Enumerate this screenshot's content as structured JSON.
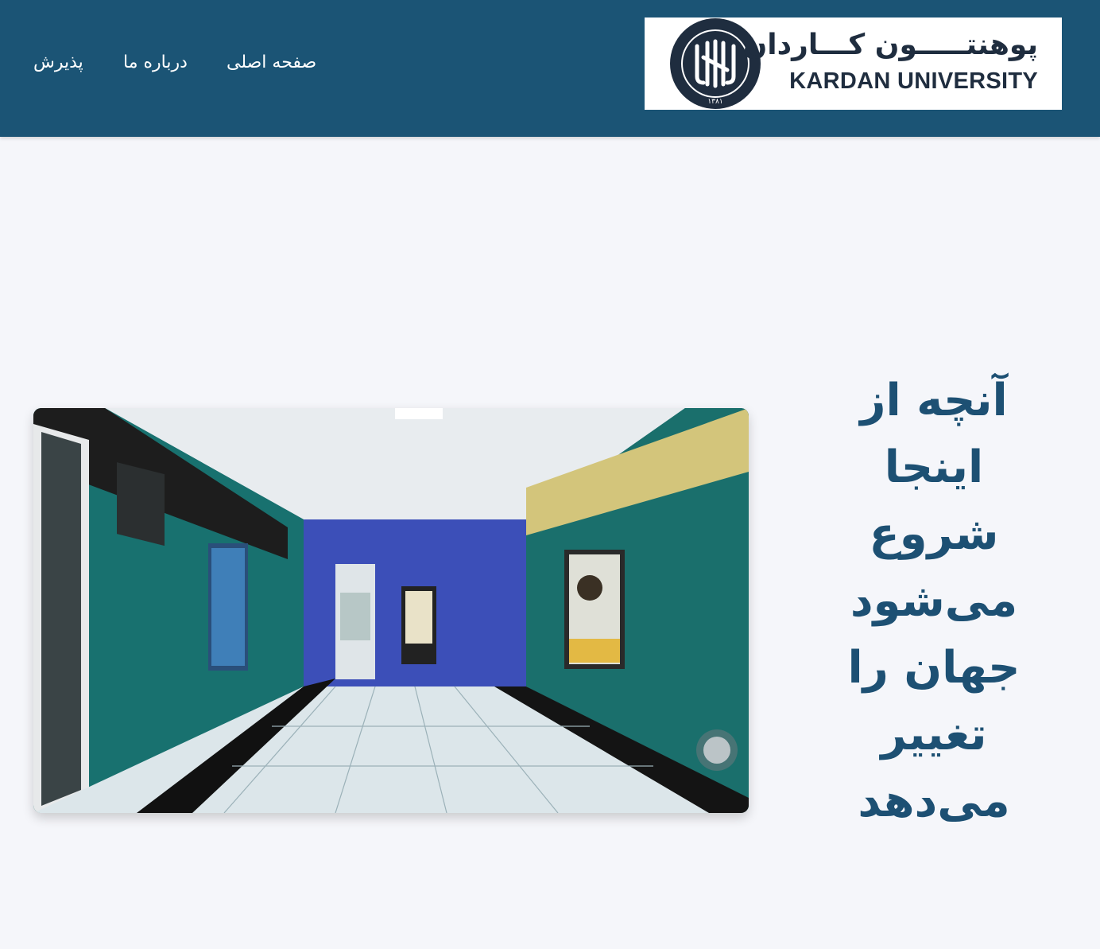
{
  "header": {
    "nav": [
      {
        "label": "صفحه اصلی"
      },
      {
        "label": "درباره ما"
      },
      {
        "label": "پذیرش"
      }
    ],
    "logo": {
      "name_fa": "پوهنتـــــون كـــاردان",
      "name_en": "KARDAN UNIVERSITY",
      "seal_text": "KARDAN UNIVERSITY",
      "seal_year": "۱۳۸۱"
    }
  },
  "hero": {
    "headline_lines": [
      "آنچه از",
      "اینجا",
      "شروع",
      "می‌شود",
      "جهان را",
      "تغییر",
      "می‌دهد"
    ],
    "video_scene": "university-hallway"
  },
  "colors": {
    "header_bg": "#1b5475",
    "page_bg": "#f5f6fa",
    "headline": "#1d5073"
  }
}
